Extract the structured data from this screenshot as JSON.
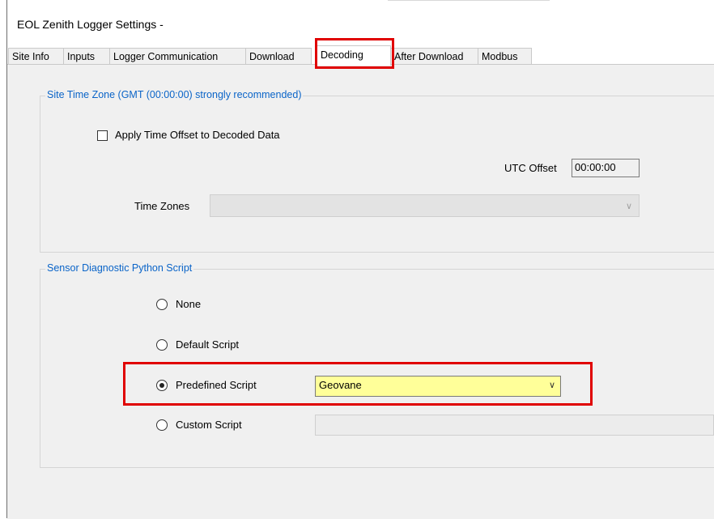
{
  "window": {
    "title": "EOL Zenith Logger Settings -"
  },
  "tabs": [
    {
      "label": "Site Info"
    },
    {
      "label": "Inputs"
    },
    {
      "label": "Logger Communication"
    },
    {
      "label": "Download"
    },
    {
      "label": "Decoding",
      "active": true
    },
    {
      "label": "After Download"
    },
    {
      "label": "Modbus"
    }
  ],
  "time_zone_group": {
    "legend": "Site Time Zone (GMT (00:00:00) strongly recommended)",
    "apply_offset_label": "Apply Time Offset to Decoded Data",
    "apply_offset_checked": false,
    "utc_offset_label": "UTC Offset",
    "utc_offset_value": "00:00:00",
    "time_zones_label": "Time Zones",
    "time_zones_value": ""
  },
  "script_group": {
    "legend": "Sensor Diagnostic Python Script",
    "options": [
      {
        "label": "None",
        "checked": false
      },
      {
        "label": "Default Script",
        "checked": false
      },
      {
        "label": "Predefined Script",
        "checked": true
      },
      {
        "label": "Custom Script",
        "checked": false
      }
    ],
    "predefined_value": "Geovane",
    "custom_value": ""
  },
  "colors": {
    "highlight_frame": "#e00000",
    "legend_text": "#0a64c8",
    "predefined_combo_bg": "#ffff99"
  }
}
